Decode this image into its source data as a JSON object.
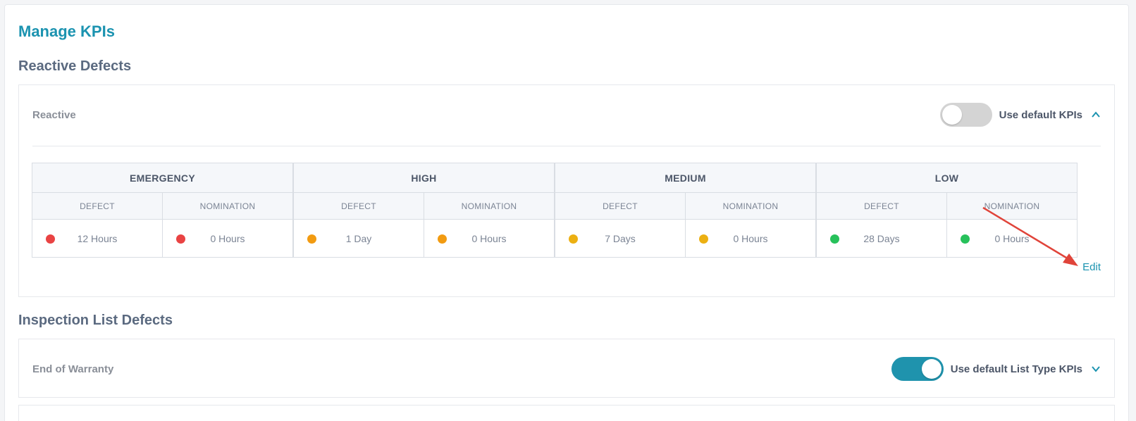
{
  "page_title": "Manage KPIs",
  "sections": {
    "reactive": {
      "title": "Reactive Defects",
      "panel_label": "Reactive",
      "toggle_label": "Use default KPIs",
      "toggle_on": false,
      "edit_label": "Edit",
      "priorities": [
        {
          "name": "EMERGENCY",
          "defect_header": "DEFECT",
          "nomination_header": "NOMINATION",
          "defect_value": "12 Hours",
          "nomination_value": "0 Hours",
          "color": "#e94343"
        },
        {
          "name": "HIGH",
          "defect_header": "DEFECT",
          "nomination_header": "NOMINATION",
          "defect_value": "1 Day",
          "nomination_value": "0 Hours",
          "color": "#f29b11"
        },
        {
          "name": "MEDIUM",
          "defect_header": "DEFECT",
          "nomination_header": "NOMINATION",
          "defect_value": "7 Days",
          "nomination_value": "0 Hours",
          "color": "#ecb012"
        },
        {
          "name": "LOW",
          "defect_header": "DEFECT",
          "nomination_header": "NOMINATION",
          "defect_value": "28 Days",
          "nomination_value": "0 Hours",
          "color": "#27c15b"
        }
      ]
    },
    "inspection": {
      "title": "Inspection List Defects",
      "panel_label": "End of Warranty",
      "toggle_label": "Use default List Type KPIs",
      "toggle_on": true
    }
  },
  "colors": {
    "accent": "#1b93b0",
    "annotation_arrow": "#e0443a"
  }
}
